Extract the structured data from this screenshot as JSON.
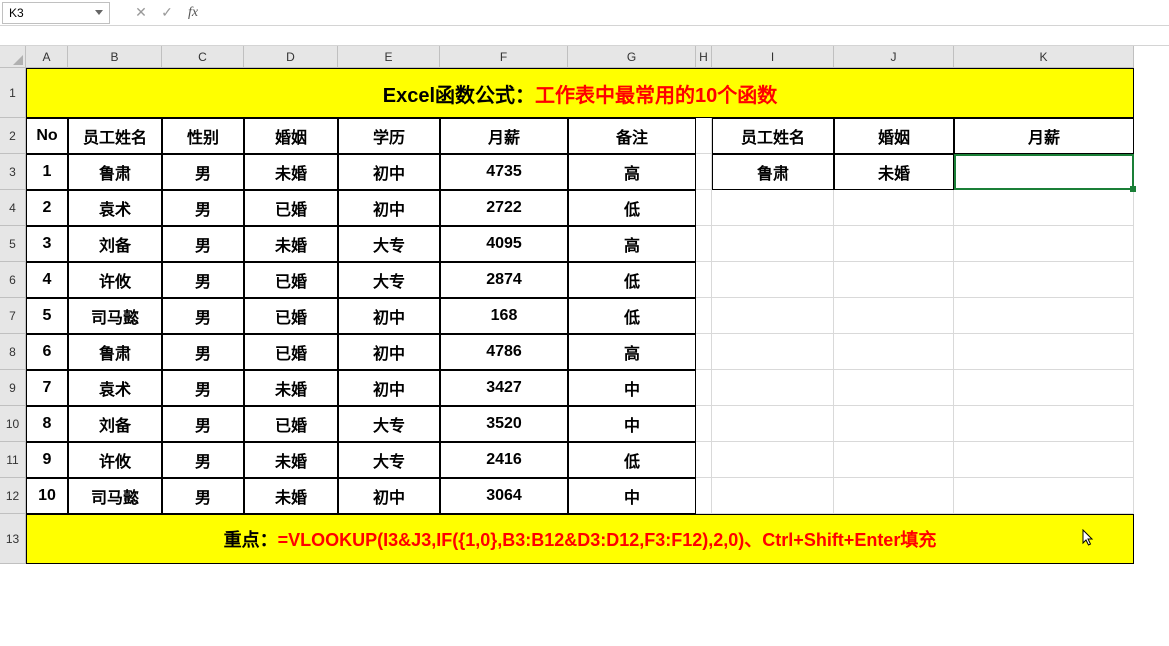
{
  "namebox": "K3",
  "columns": [
    "A",
    "B",
    "C",
    "D",
    "E",
    "F",
    "G",
    "H",
    "I",
    "J",
    "K"
  ],
  "row_numbers": [
    "1",
    "2",
    "3",
    "4",
    "5",
    "6",
    "7",
    "8",
    "9",
    "10",
    "11",
    "12",
    "13"
  ],
  "title": {
    "prefix": "Excel函数公式：",
    "main": "工作表中最常用的10个函数"
  },
  "headers_left": [
    "No",
    "员工姓名",
    "性别",
    "婚姻",
    "学历",
    "月薪",
    "备注"
  ],
  "headers_right": [
    "员工姓名",
    "婚姻",
    "月薪"
  ],
  "rows": [
    {
      "no": "1",
      "name": "鲁肃",
      "gender": "男",
      "marriage": "未婚",
      "edu": "初中",
      "salary": "4735",
      "remark": "高"
    },
    {
      "no": "2",
      "name": "袁术",
      "gender": "男",
      "marriage": "已婚",
      "edu": "初中",
      "salary": "2722",
      "remark": "低"
    },
    {
      "no": "3",
      "name": "刘备",
      "gender": "男",
      "marriage": "未婚",
      "edu": "大专",
      "salary": "4095",
      "remark": "高"
    },
    {
      "no": "4",
      "name": "许攸",
      "gender": "男",
      "marriage": "已婚",
      "edu": "大专",
      "salary": "2874",
      "remark": "低"
    },
    {
      "no": "5",
      "name": "司马懿",
      "gender": "男",
      "marriage": "已婚",
      "edu": "初中",
      "salary": "168",
      "remark": "低"
    },
    {
      "no": "6",
      "name": "鲁肃",
      "gender": "男",
      "marriage": "已婚",
      "edu": "初中",
      "salary": "4786",
      "remark": "高"
    },
    {
      "no": "7",
      "name": "袁术",
      "gender": "男",
      "marriage": "未婚",
      "edu": "初中",
      "salary": "3427",
      "remark": "中"
    },
    {
      "no": "8",
      "name": "刘备",
      "gender": "男",
      "marriage": "已婚",
      "edu": "大专",
      "salary": "3520",
      "remark": "中"
    },
    {
      "no": "9",
      "name": "许攸",
      "gender": "男",
      "marriage": "未婚",
      "edu": "大专",
      "salary": "2416",
      "remark": "低"
    },
    {
      "no": "10",
      "name": "司马懿",
      "gender": "男",
      "marriage": "未婚",
      "edu": "初中",
      "salary": "3064",
      "remark": "中"
    }
  ],
  "lookup": {
    "name": "鲁肃",
    "marriage": "未婚",
    "salary": ""
  },
  "footer": {
    "label": "重点：",
    "formula": "=VLOOKUP(I3&J3,IF({1,0},B3:B12&D3:D12,F3:F12),2,0)、Ctrl+Shift+Enter填充"
  },
  "icons": {
    "cancel": "✕",
    "confirm": "✓",
    "fx": "fx"
  }
}
